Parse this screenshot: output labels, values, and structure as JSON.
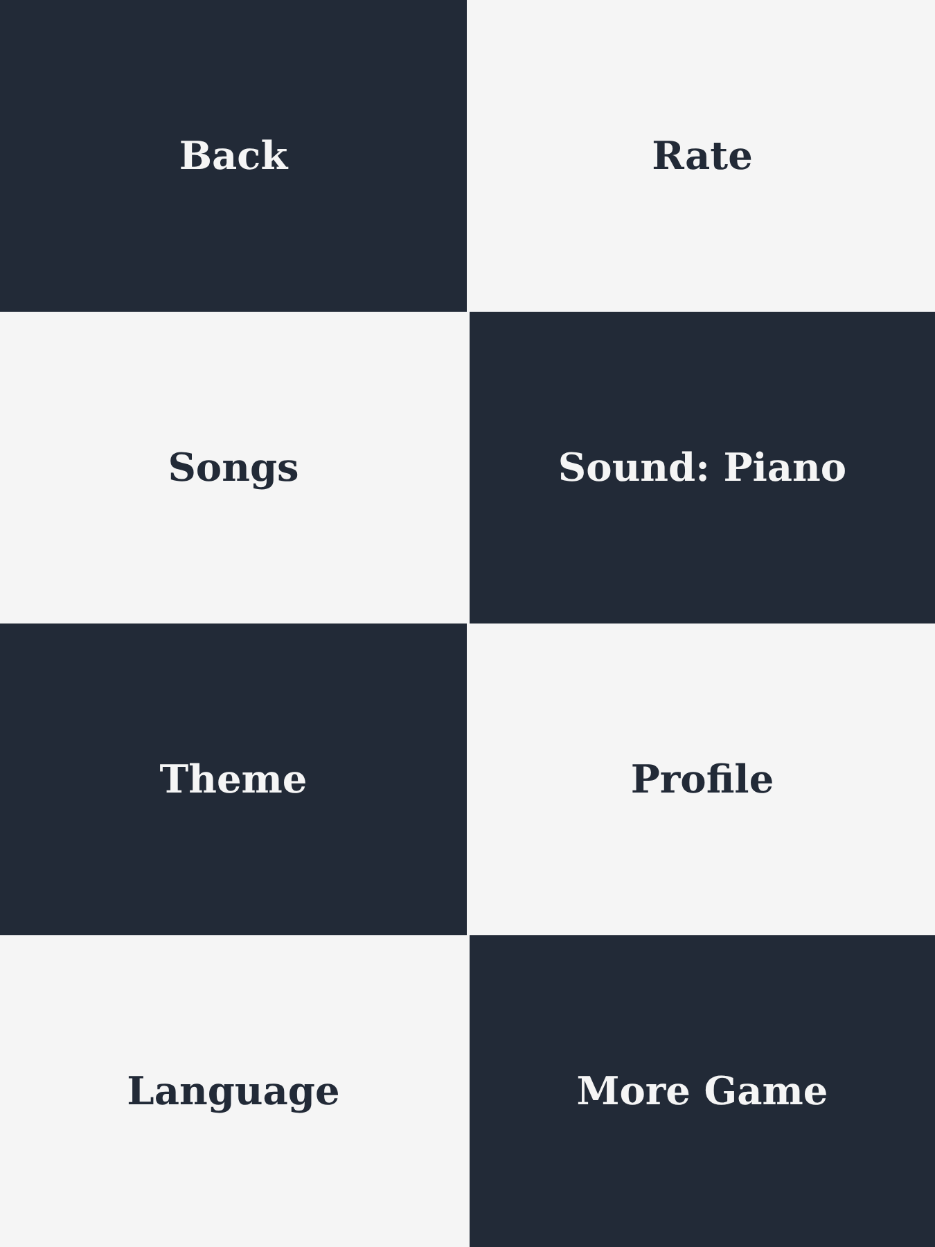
{
  "menu": [
    {
      "label": "Back",
      "color": "#222a37"
    },
    {
      "label": "Rate",
      "color": "#f5f5f5"
    },
    {
      "label": "Songs",
      "color": "#f5f5f5"
    },
    {
      "label": "Sound: Piano",
      "color": "#222a37"
    },
    {
      "label": "Theme",
      "color": "#222a37"
    },
    {
      "label": "Profile",
      "color": "#f5f5f5"
    },
    {
      "label": "Language",
      "color": "#f5f5f5"
    },
    {
      "label": "More Game",
      "color": "#222a37"
    }
  ]
}
